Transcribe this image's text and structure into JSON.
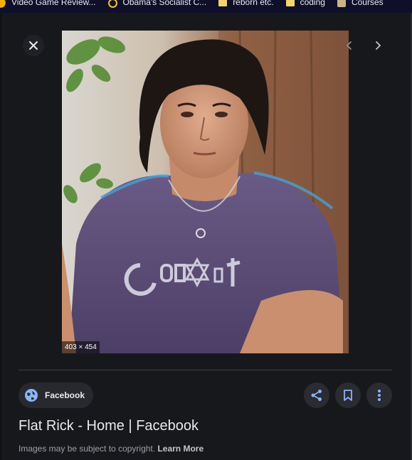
{
  "bookmarks": [
    {
      "label": "Video Game Review...",
      "icon": "game-favicon-icon"
    },
    {
      "label": "Obama's Socialist C...",
      "icon": "ring-favicon-icon"
    },
    {
      "label": "reborn etc.",
      "icon": "folder-icon"
    },
    {
      "label": "coding",
      "icon": "folder-icon"
    },
    {
      "label": "Courses",
      "icon": "course-favicon-icon"
    }
  ],
  "viewer": {
    "close_icon": "close-icon",
    "prev_icon": "chevron-left-icon",
    "next_icon": "chevron-right-icon",
    "image_dimensions": "403 × 454"
  },
  "source": {
    "label": "Facebook",
    "icon": "globe-icon"
  },
  "actions": {
    "share_icon": "share-icon",
    "save_icon": "bookmark-icon",
    "more_icon": "more-vert-icon"
  },
  "title": "Flat Rick - Home | Facebook",
  "copyright": {
    "text": "Images may be subject to copyright.",
    "link": "Learn More"
  },
  "colors": {
    "panel_bg": "#17181c",
    "accent_blue": "#8ab4f8",
    "bookmarks_bg": "#0f0f2a"
  }
}
